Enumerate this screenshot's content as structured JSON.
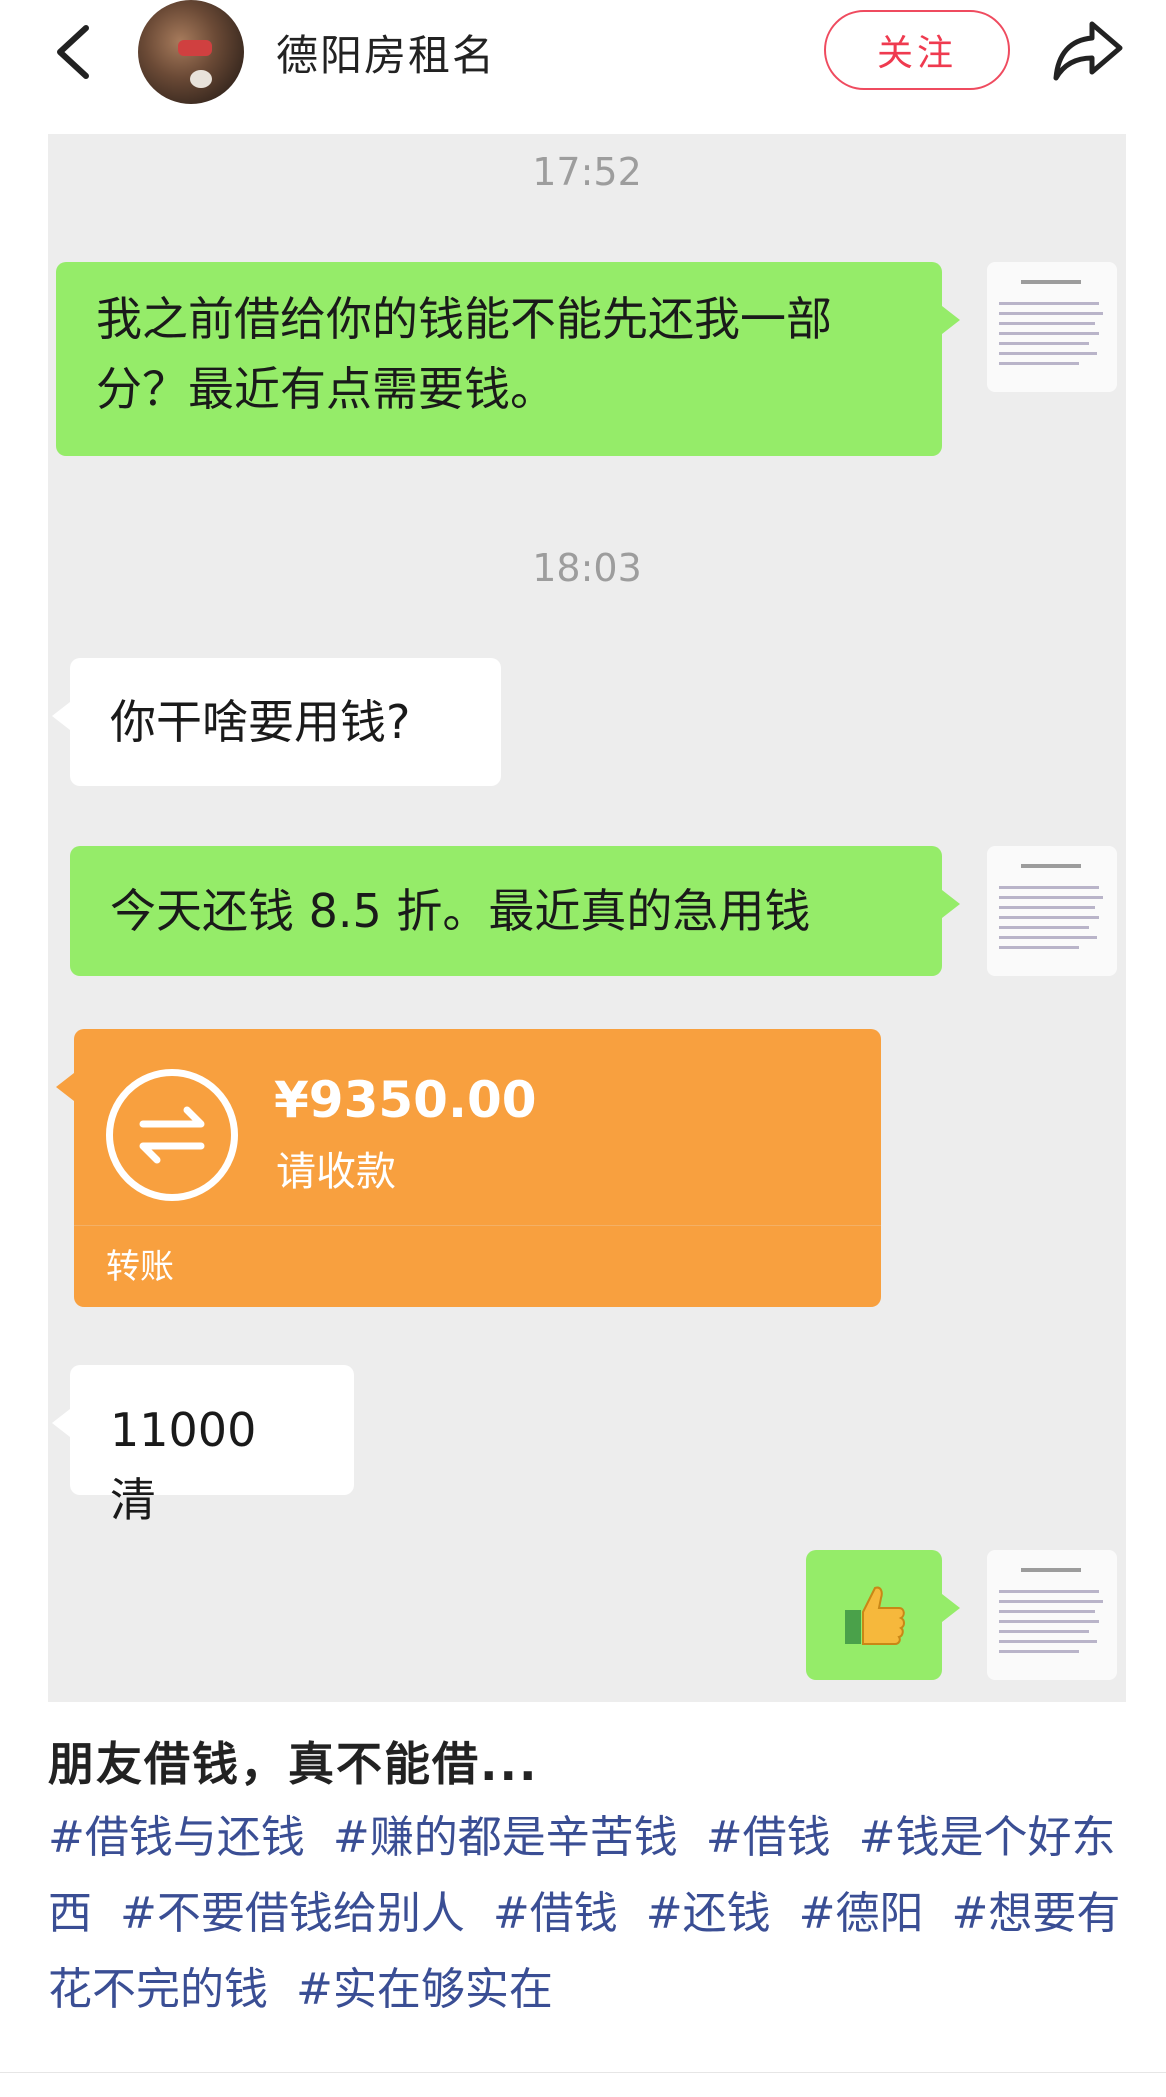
{
  "header": {
    "username": "德阳房租名",
    "follow_label": "关注"
  },
  "chat": {
    "time1": "17:52",
    "msg1": "我之前借给你的钱能不能先还我一部分？最近有点需要钱。",
    "time2": "18:03",
    "msg2": "你干啥要用钱?",
    "msg3": "今天还钱 8.5 折。最近真的急用钱",
    "transfer": {
      "amount": "¥9350.00",
      "note": "请收款",
      "label": "转账"
    },
    "msg5": "11000 清"
  },
  "post": {
    "title": "朋友借钱，真不能借...",
    "tags": [
      "#借钱与还钱",
      "#赚的都是辛苦钱",
      "#借钱",
      "#钱是个好东西",
      "#不要借钱给别人",
      "#借钱",
      "#还钱",
      "#德阳",
      "#想要有花不完的钱",
      "#实在够实在"
    ]
  },
  "colors": {
    "accent": "#ef3a4f",
    "bubble_green": "#95ec69",
    "transfer_orange": "#f8a03f",
    "tag_blue": "#3a4e94"
  }
}
